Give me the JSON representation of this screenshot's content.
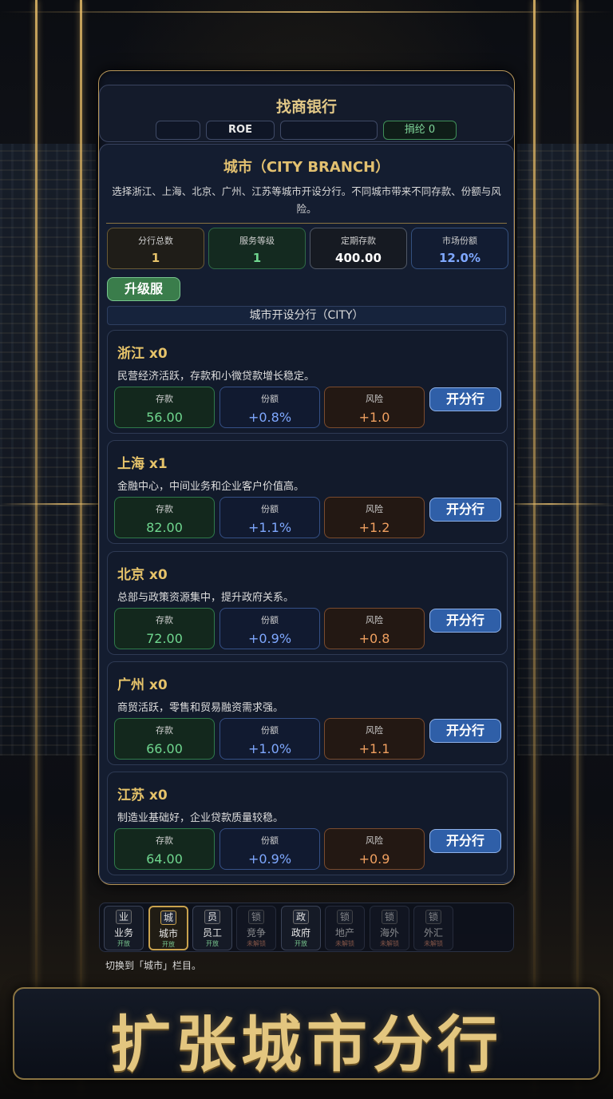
{
  "header": {
    "bank_name": "找商银行",
    "pills": [
      "",
      "ROE",
      "",
      "捐纶 0"
    ]
  },
  "city_section": {
    "title": "城市（CITY BRANCH）",
    "description": "选择浙江、上海、北京、广州、江苏等城市开设分行。不同城市带来不同存款、份额与风险。",
    "stats": [
      {
        "label": "分行总数",
        "value": "1"
      },
      {
        "label": "服务等级",
        "value": "1"
      },
      {
        "label": "定期存款",
        "value": "400.00"
      },
      {
        "label": "市场份额",
        "value": "12.0%"
      }
    ],
    "upgrade_label": "升级服",
    "list_header": "城市开设分行（CITY）",
    "metric_labels": {
      "deposit": "存款",
      "share": "份额",
      "risk": "风险"
    },
    "open_label": "开分行",
    "cities": [
      {
        "name": "浙江",
        "count": "x0",
        "desc": "民营经济活跃，存款和小微贷款增长稳定。",
        "deposit": "56.00",
        "share": "+0.8%",
        "risk": "+1.0"
      },
      {
        "name": "上海",
        "count": "x1",
        "desc": "金融中心，中间业务和企业客户价值高。",
        "deposit": "82.00",
        "share": "+1.1%",
        "risk": "+1.2"
      },
      {
        "name": "北京",
        "count": "x0",
        "desc": "总部与政策资源集中，提升政府关系。",
        "deposit": "72.00",
        "share": "+0.9%",
        "risk": "+0.8"
      },
      {
        "name": "广州",
        "count": "x0",
        "desc": "商贸活跃，零售和贸易融资需求强。",
        "deposit": "66.00",
        "share": "+1.0%",
        "risk": "+1.1"
      },
      {
        "name": "江苏",
        "count": "x0",
        "desc": "制造业基础好，企业贷款质量较稳。",
        "deposit": "64.00",
        "share": "+0.9%",
        "risk": "+0.9"
      }
    ]
  },
  "nav": {
    "tabs": [
      {
        "glyph": "业",
        "label": "业务",
        "state": "开放"
      },
      {
        "glyph": "城",
        "label": "城市",
        "state": "开放"
      },
      {
        "glyph": "员",
        "label": "员工",
        "state": "开放"
      },
      {
        "glyph": "锁",
        "label": "竞争",
        "state": "未解锁"
      },
      {
        "glyph": "政",
        "label": "政府",
        "state": "开放"
      },
      {
        "glyph": "锁",
        "label": "地产",
        "state": "未解锁"
      },
      {
        "glyph": "锁",
        "label": "海外",
        "state": "未解锁"
      },
      {
        "glyph": "锁",
        "label": "外汇",
        "state": "未解锁"
      }
    ],
    "hint": "切换到「城市」栏目。"
  },
  "banner": {
    "text": "扩张城市分行"
  },
  "colors": {
    "gold": "#e2c070",
    "green": "#6fd68e",
    "blue": "#7fa8ff",
    "orange": "#f0a060",
    "button_blue": "#2f5fa8"
  }
}
